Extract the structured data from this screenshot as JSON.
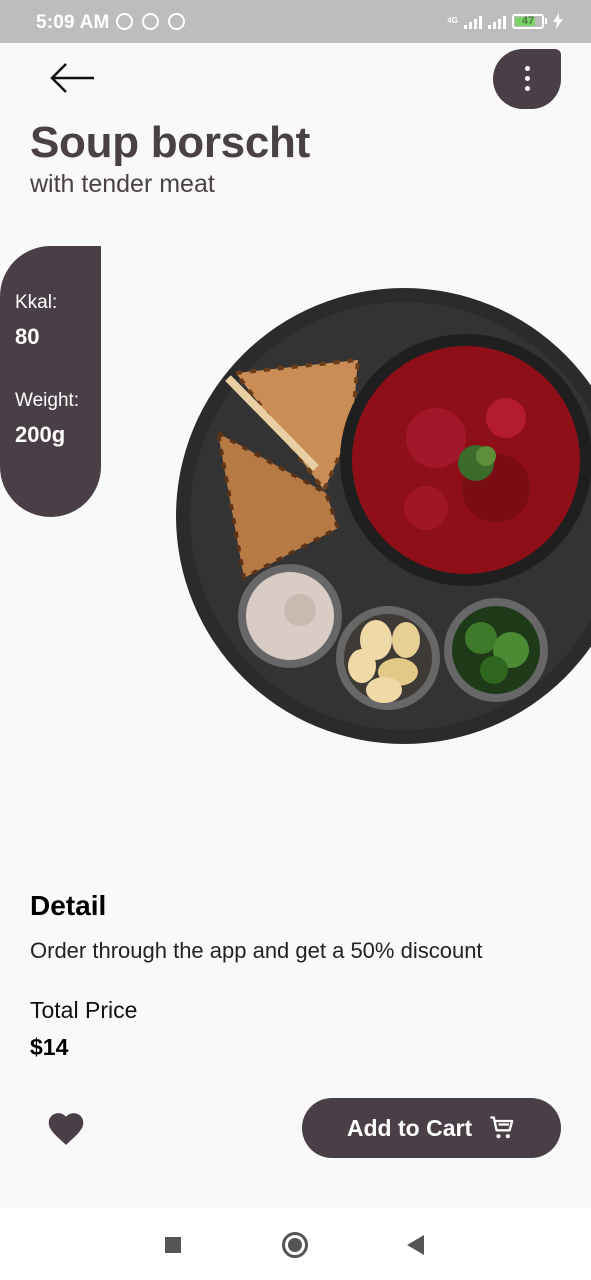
{
  "status_bar": {
    "time": "5:09 AM",
    "network": "4G",
    "battery": "47",
    "icons": [
      "alarm-icon",
      "vpn-icon",
      "sync-icon",
      "signal-icon",
      "charging-icon"
    ]
  },
  "header": {
    "back_icon": "arrow-left-icon",
    "menu_icon": "more-vertical-icon"
  },
  "product": {
    "title": "Soup borscht",
    "subtitle": "with tender meat",
    "kkal_label": "Kkal:",
    "kkal_value": "80",
    "weight_label": "Weight:",
    "weight_value": "200g",
    "image_icon": "borscht-plate-image"
  },
  "detail": {
    "heading": "Detail",
    "text": "Order through the app and get a 50% discount",
    "total_label": "Total Price",
    "total_value": "$14"
  },
  "actions": {
    "favorite_icon": "heart-icon",
    "add_to_cart_label": "Add to Cart",
    "cart_icon": "cart-icon"
  },
  "colors": {
    "accent": "#4a3f46",
    "background": "#f9f9f9",
    "status_bar": "#bdbdbd"
  }
}
